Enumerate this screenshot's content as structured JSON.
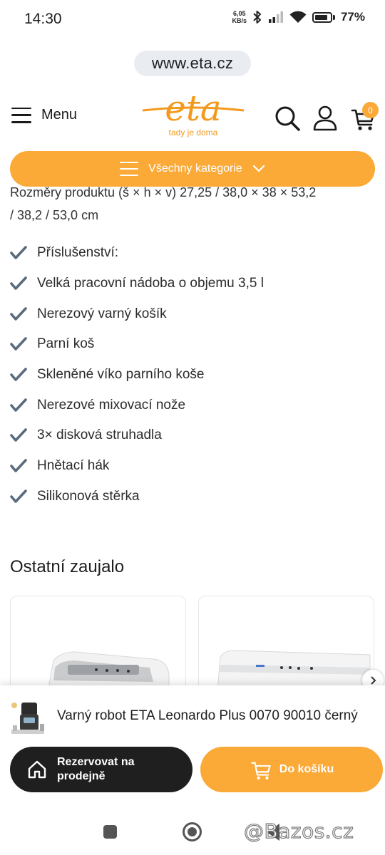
{
  "status_bar": {
    "time": "14:30",
    "net_speed_value": "6,05",
    "net_speed_unit": "KB/s",
    "battery": "77%",
    "battery_level": 0.77
  },
  "browser": {
    "url": "www.eta.cz"
  },
  "header": {
    "menu_label": "Menu",
    "logo_text": "eta",
    "logo_tagline": "tady je doma",
    "cart_count": "0",
    "brand_color": "#f39a1e",
    "accent_color": "#fba937"
  },
  "category_bar": {
    "label": "Všechny kategorie"
  },
  "content": {
    "partial_line_1": "Rozměry produktu (š × h × v) 27,25 / 38,0 × 38 × 53,2",
    "partial_line_2": "/ 38,2 / 53,0 cm",
    "accessories": [
      "Příslušenství:",
      "Velká pracovní nádoba o objemu 3,5 l",
      "Nerezový varný košík",
      "Parní koš",
      "Skleněné víko parního koše",
      "Nerezové mixovací nože",
      "3× disková struhadla",
      "Hnětací hák",
      "Silikonová stěrka"
    ],
    "section_title": "Ostatní zaujalo"
  },
  "sticky_bar": {
    "product_title": "Varný robot ETA Leonardo Plus 0070 90010 černý",
    "reserve_label": "Rezervovat na prodejně",
    "cart_label": "Do košíku"
  },
  "watermark": "@Bazos.cz"
}
